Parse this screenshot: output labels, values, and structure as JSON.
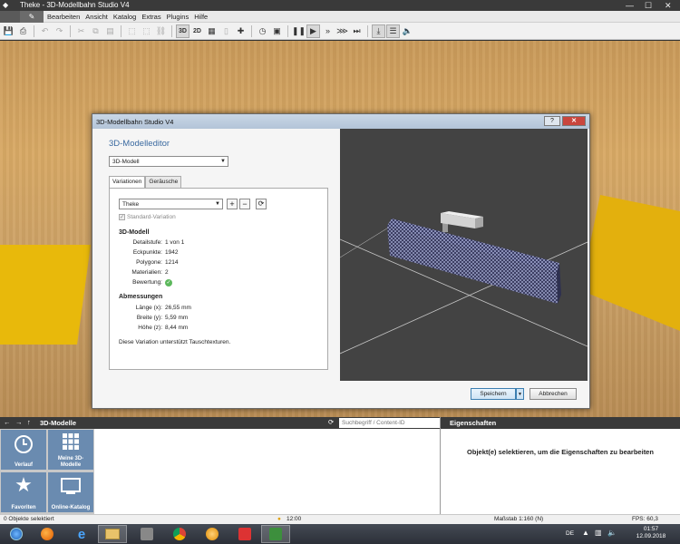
{
  "window": {
    "title": "Theke - 3D-Modellbahn Studio V4"
  },
  "menu": {
    "items": [
      "Bearbeiten",
      "Ansicht",
      "Katalog",
      "Extras",
      "Plugins",
      "Hilfe"
    ]
  },
  "toolbar": {
    "btn_3d": "3D",
    "btn_2d": "2D"
  },
  "dialog": {
    "title": "3D-Modellbahn Studio V4",
    "help": "?",
    "editor_title": "3D-Modelleditor",
    "model_type": "3D-Modell",
    "tabs": [
      "Variationen",
      "Geräusche"
    ],
    "variation": "Theke",
    "standard_variation": "Standard-Variation",
    "model_heading": "3D-Modell",
    "model_props": [
      {
        "key": "Detailstufe:",
        "value": "1 von 1"
      },
      {
        "key": "Eckpunkte:",
        "value": "1942"
      },
      {
        "key": "Polygone:",
        "value": "1214"
      },
      {
        "key": "Materialien:",
        "value": "2"
      },
      {
        "key": "Bewertung:",
        "value": ""
      }
    ],
    "dims_heading": "Abmessungen",
    "dims": [
      {
        "key": "Länge (x):",
        "value": "26,55 mm"
      },
      {
        "key": "Breite (y):",
        "value": "5,59 mm"
      },
      {
        "key": "Höhe (z):",
        "value": "8,44 mm"
      }
    ],
    "note": "Diese Variation unterstützt Tauschtexturen.",
    "save": "Speichern",
    "cancel": "Abbrechen"
  },
  "library": {
    "title": "3D-Modelle",
    "search_placeholder": "Suchbegriff / Content-ID",
    "tiles": [
      {
        "label": "Verlauf",
        "icon": "clock-icon"
      },
      {
        "label": "Meine 3D-Modelle",
        "icon": "grid-icon"
      },
      {
        "label": "Favoriten",
        "icon": "star-icon"
      },
      {
        "label": "Online-Katalog",
        "icon": "catalog-icon"
      }
    ]
  },
  "properties": {
    "title": "Eigenschaften",
    "message": "Objekt(e) selektieren, um die Eigenschaften zu bearbeiten"
  },
  "status": {
    "selection": "0 Objekte selektiert",
    "time": "12:00",
    "scale": "Maßstab 1:160 (N)",
    "fps": "FPS: 60,3"
  },
  "taskbar": {
    "lang": "DE",
    "clock_time": "01:57",
    "clock_date": "12.09.2018"
  },
  "colors": {
    "accent": "#3b6aa0",
    "tile": "#6a8bb0",
    "rating_ok": "#5cb85c"
  }
}
